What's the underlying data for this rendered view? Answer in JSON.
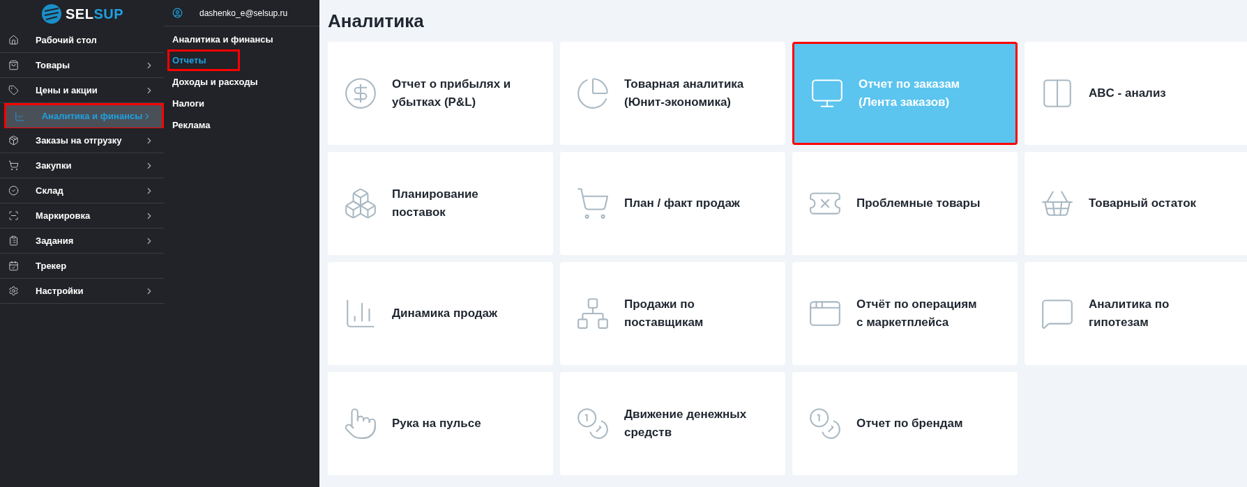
{
  "logo": {
    "text_a": "SEL",
    "text_b": "SUP"
  },
  "sidebar": {
    "items": [
      {
        "label": "Рабочий стол",
        "has_submenu": false,
        "selected": false
      },
      {
        "label": "Товары",
        "has_submenu": true,
        "selected": false
      },
      {
        "label": "Цены и акции",
        "has_submenu": true,
        "selected": false
      },
      {
        "label": "Аналитика и финансы",
        "has_submenu": true,
        "selected": true
      },
      {
        "label": "Заказы на отгрузку",
        "has_submenu": true,
        "selected": false
      },
      {
        "label": "Закупки",
        "has_submenu": true,
        "selected": false
      },
      {
        "label": "Склад",
        "has_submenu": true,
        "selected": false
      },
      {
        "label": "Маркировка",
        "has_submenu": true,
        "selected": false
      },
      {
        "label": "Задания",
        "has_submenu": true,
        "selected": false
      },
      {
        "label": "Трекер",
        "has_submenu": false,
        "selected": false
      },
      {
        "label": "Настройки",
        "has_submenu": true,
        "selected": false
      }
    ]
  },
  "submenu": {
    "user": "dashenko_e@selsup.ru",
    "heading": "Аналитика и финансы",
    "items": [
      {
        "label": "Отчеты",
        "selected": true
      },
      {
        "label": "Доходы и расходы",
        "selected": false
      },
      {
        "label": "Налоги",
        "selected": false
      },
      {
        "label": "Реклама",
        "selected": false
      }
    ]
  },
  "page": {
    "title": "Аналитика",
    "cards": [
      {
        "label": "Отчет о прибылях и убытках (P&L)",
        "selected": false
      },
      {
        "label": "Товарная аналитика (Юнит-экономика)",
        "selected": false
      },
      {
        "label": "Отчет по заказам (Лента заказов)",
        "selected": true
      },
      {
        "label": "ABC - анализ",
        "selected": false
      },
      {
        "label": "Планирование поставок",
        "selected": false
      },
      {
        "label": "План / факт продаж",
        "selected": false
      },
      {
        "label": "Проблемные товары",
        "selected": false
      },
      {
        "label": "Товарный остаток",
        "selected": false
      },
      {
        "label": "Динамика продаж",
        "selected": false
      },
      {
        "label": "Продажи по поставщикам",
        "selected": false
      },
      {
        "label": "Отчёт по операциям с маркетплейса",
        "selected": false
      },
      {
        "label": "Аналитика по гипотезам",
        "selected": false
      },
      {
        "label": "Рука на пульсе",
        "selected": false
      },
      {
        "label": "Движение денежных средств",
        "selected": false
      },
      {
        "label": "Отчет по брендам",
        "selected": false
      }
    ]
  }
}
